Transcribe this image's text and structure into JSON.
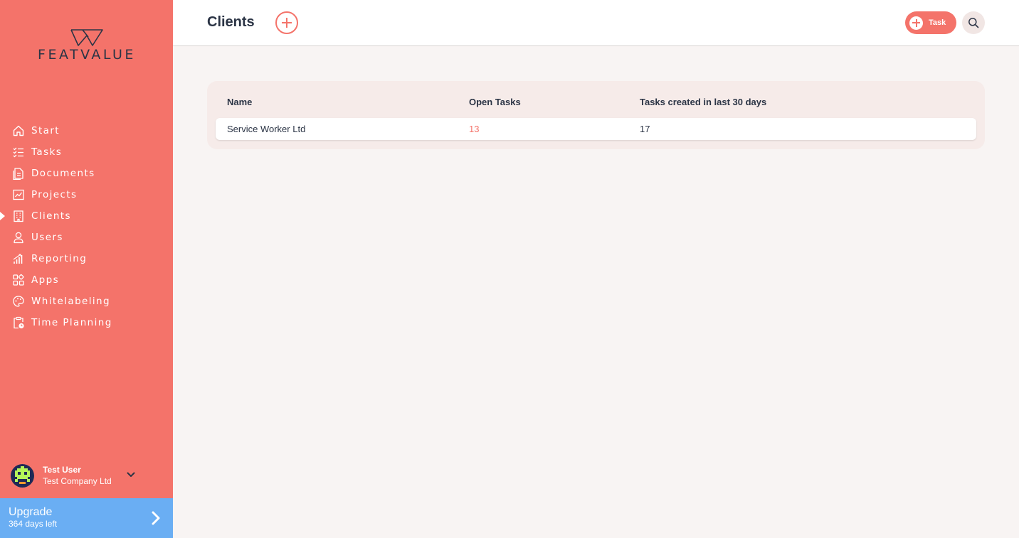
{
  "brand": {
    "name": "FEATVALUE",
    "accent": "#f4736a",
    "upgrade_color": "#6aaef3"
  },
  "sidebar": {
    "items": [
      {
        "label": "Start",
        "icon": "home-icon"
      },
      {
        "label": "Tasks",
        "icon": "checklist-icon"
      },
      {
        "label": "Documents",
        "icon": "document-icon"
      },
      {
        "label": "Projects",
        "icon": "project-chart-icon"
      },
      {
        "label": "Clients",
        "icon": "building-icon",
        "active": true
      },
      {
        "label": "Users",
        "icon": "user-icon"
      },
      {
        "label": "Reporting",
        "icon": "bar-chart-icon"
      },
      {
        "label": "Apps",
        "icon": "apps-grid-icon"
      },
      {
        "label": "Whitelabeling",
        "icon": "palette-icon"
      },
      {
        "label": "Time Planning",
        "icon": "clipboard-clock-icon"
      }
    ],
    "user": {
      "name": "Test User",
      "company": "Test Company Ltd"
    },
    "upgrade": {
      "title": "Upgrade",
      "subtitle": "364 days left"
    }
  },
  "header": {
    "title": "Clients",
    "task_button_label": "Task"
  },
  "table": {
    "columns": [
      "Name",
      "Open Tasks",
      "Tasks created in last 30 days"
    ],
    "rows": [
      {
        "name": "Service Worker Ltd",
        "open_tasks": "13",
        "tasks_30_days": "17"
      }
    ]
  }
}
